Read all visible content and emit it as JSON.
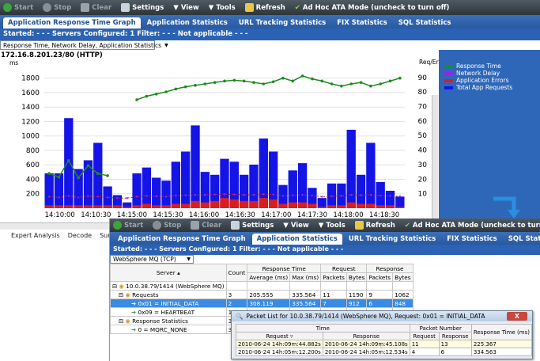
{
  "toolbar": {
    "items": [
      {
        "label": "Start",
        "icon": "play-icon"
      },
      {
        "label": "Stop",
        "icon": "stop-icon"
      },
      {
        "label": "Clear",
        "icon": "clear-icon"
      },
      {
        "label": "Settings",
        "icon": "settings-icon"
      },
      {
        "label": "View",
        "icon": "view-icon"
      },
      {
        "label": "Tools",
        "icon": "tools-icon"
      },
      {
        "label": "Refresh",
        "icon": "refresh-icon"
      },
      {
        "label": "Ad Hoc ATA Mode (uncheck to turn off)",
        "icon": "check-icon"
      }
    ]
  },
  "main": {
    "tabs": [
      "Application Response Time Graph",
      "Application Statistics",
      "URL Tracking Statistics",
      "FIX Statistics",
      "SQL Statistics"
    ],
    "active_tab": 0,
    "info": "Started:  - - -   Servers Configured:  1    Filter:  - - -  Not applicable  - - -",
    "view_select": "Response Time, Network Delay, Application Statistics",
    "server_label": "172.16.8.201.23/80 (HTTP)",
    "legend": [
      {
        "label": "Response Time",
        "color": "#1e8c1e"
      },
      {
        "label": "Network Delay",
        "color": "#8a2be2"
      },
      {
        "label": "Application Errors",
        "color": "#d81e1e"
      },
      {
        "label": "Total App Requests",
        "color": "#1414e6"
      }
    ],
    "bottom_tabs": [
      "Expert Analysis",
      "Decode",
      "Sum"
    ]
  },
  "chart_data": {
    "type": "bar",
    "ylabel_left": "ms",
    "ylabel_right": "Req/Err",
    "x_ticks": [
      "14:10:00",
      "14:10:30",
      "14:15:00",
      "14:15:30",
      "14:16:00",
      "14:16:30",
      "14:17:00",
      "14:17:30",
      "14:18:00",
      "14:18:30"
    ],
    "y_ticks_left": [
      "200",
      "400",
      "600",
      "800",
      "1000",
      "1200",
      "1400",
      "1600",
      "1800"
    ],
    "y_ticks_right": [
      "10",
      "20",
      "30",
      "40",
      "50",
      "60",
      "70",
      "80",
      "90"
    ],
    "ylim_left": [
      0,
      1950
    ],
    "ylim_right": [
      0,
      97
    ],
    "categories_count": 37,
    "series": [
      {
        "name": "Total App Requests",
        "axis": "right",
        "values": [
          24,
          24,
          62,
          27,
          33,
          45,
          15,
          9,
          4,
          24,
          28,
          21,
          19,
          32,
          39,
          57,
          25,
          23,
          34,
          32,
          23,
          30,
          48,
          39,
          16,
          26,
          31,
          14,
          7,
          17,
          17,
          54,
          23,
          45,
          18,
          12,
          8
        ]
      },
      {
        "name": "Application Errors",
        "axis": "right",
        "values": [
          2,
          2,
          2,
          2,
          2,
          2,
          2,
          2,
          1,
          2,
          3,
          2,
          2,
          3,
          3,
          5,
          4,
          5,
          7,
          6,
          5,
          5,
          7,
          6,
          3,
          4,
          4,
          3,
          1,
          2,
          2,
          4,
          3,
          3,
          2,
          2,
          1
        ]
      },
      {
        "name": "Response Time",
        "axis": "left",
        "values": [
          480,
          430,
          660,
          420,
          590,
          480,
          450,
          0,
          0,
          1500,
          1550,
          1580,
          1610,
          1650,
          1680,
          1700,
          1720,
          1740,
          1760,
          1770,
          1760,
          1740,
          1720,
          1750,
          1800,
          1760,
          1830,
          1790,
          1760,
          1720,
          1690,
          1720,
          1740,
          1690,
          1720,
          1760,
          1800
        ]
      },
      {
        "name": "Network Delay",
        "axis": "left",
        "values": [
          160,
          150,
          170,
          150,
          165,
          160,
          150,
          140,
          140,
          160,
          170,
          165,
          160,
          175,
          180,
          185,
          185,
          190,
          195,
          190,
          185,
          185,
          195,
          190,
          170,
          180,
          185,
          175,
          160,
          165,
          170,
          185,
          180,
          185,
          175,
          170,
          165
        ]
      }
    ]
  },
  "second": {
    "tabs": [
      "Application Response Time Graph",
      "Application Statistics",
      "URL Tracking Statistics",
      "FIX Statistics",
      "SQL Statistics"
    ],
    "active_tab": 1,
    "info": "Started:  - - -   Servers Configured:  1    Filter:  - - -  Not applicable  - - -",
    "protocol_select": "WebSphere MQ (TCP)",
    "headers": {
      "server": "Server",
      "count": "Count",
      "rt": "Response Time",
      "rt_avg": "Average (ms)",
      "rt_max": "Max (ms)",
      "req": "Request",
      "resp": "Response",
      "packets": "Packets",
      "bytes": "Bytes"
    },
    "rows": [
      {
        "server": "10.0.38.79/1414 (WebSphere MQ)",
        "count": "",
        "avg": "",
        "max": "",
        "rq_p": "",
        "rq_b": "",
        "rs_p": "",
        "rs_b": ""
      },
      {
        "server": "Requests",
        "count": "3",
        "avg": "205.555",
        "max": "335.564",
        "rq_p": "11",
        "rq_b": "1190",
        "rs_p": "9",
        "rs_b": "1062"
      },
      {
        "server": "0x01 = INITIAL_DATA",
        "count": "2",
        "avg": "308.119",
        "max": "335.564",
        "rq_p": "7",
        "rq_b": "912",
        "rs_p": "6",
        "rs_b": "848"
      },
      {
        "server": "0x09 = HEARTBEAT",
        "count": "1",
        "avg": "0.428",
        "max": "0.428",
        "rq_p": "4",
        "rq_b": "278",
        "rs_p": "3",
        "rs_b": "214"
      },
      {
        "server": "Response Statistics",
        "count": "3",
        "avg": "",
        "max": "",
        "rq_p": "",
        "rq_b": "",
        "rs_p": "",
        "rs_b": ""
      },
      {
        "server": "0 = MQRC_NONE",
        "count": "3",
        "avg": "",
        "max": "",
        "rq_p": "",
        "rq_b": "",
        "rs_p": "",
        "rs_b": ""
      }
    ]
  },
  "dialog": {
    "title": "Packet List for 10.0.38.79/1414 (WebSphere MQ), Request: 0x01 = INITIAL_DATA",
    "close": "X",
    "h_time": "Time",
    "h_packet": "Packet Number",
    "h_request": "Request",
    "h_response": "Response",
    "h_rt": "Response Time (ms)",
    "rows": [
      {
        "req": "2010-06-24 14h:09m:44.882s",
        "resp": "2010-06-24 14h:09m:45.108s",
        "pq": "11",
        "pr": "13",
        "rt": "225.367"
      },
      {
        "req": "2010-06-24 14h:05m:12.200s",
        "resp": "2010-06-24 14h:05m:12.534s",
        "pq": "4",
        "pr": "6",
        "rt": "334.563"
      }
    ]
  }
}
